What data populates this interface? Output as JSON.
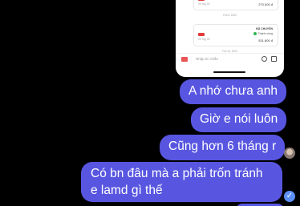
{
  "shared_screenshot": {
    "card1": {
      "date": "09 thg 02",
      "amount": "270.000 đ"
    },
    "center_date_1": "Feb 6, 2022",
    "card2": {
      "status": "ĐÃ CHUYỂN",
      "date": "09 thg 02",
      "sub_status": "Thành công",
      "amount": "531.800 đ"
    },
    "center_date_2": "Feb 10, 2022",
    "input_placeholder": "Nhập tin nhắn"
  },
  "messages": [
    {
      "text": "A nhớ chưa anh"
    },
    {
      "text": "Giờ e nói luôn"
    },
    {
      "text": "Cũng hơn 6 tháng r"
    },
    {
      "text": "Có bn đâu mà a phải trốn tránh e lamd gì thế"
    }
  ],
  "read_receipt_glyph": "✓",
  "colors": {
    "bubble": "#5856e0",
    "background": "#000000",
    "read_receipt": "#5b8ff5"
  }
}
